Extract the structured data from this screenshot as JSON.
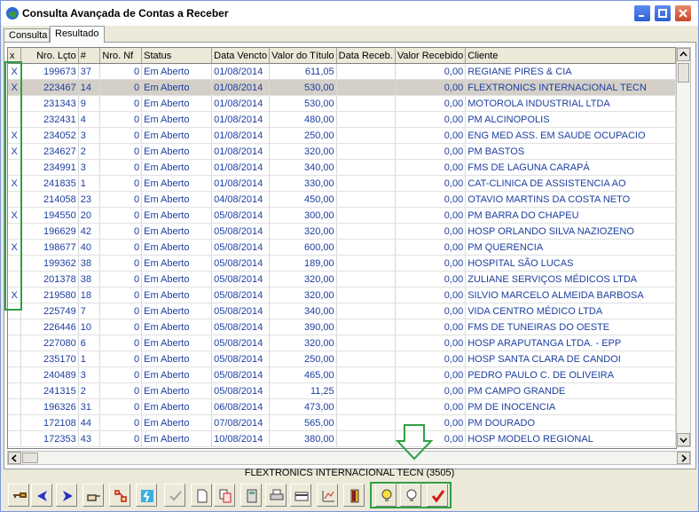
{
  "window": {
    "title": "Consulta Avançada de Contas a Receber"
  },
  "tabs": [
    {
      "label": "Consulta"
    },
    {
      "label": "Resultado"
    }
  ],
  "columns": [
    "x",
    "Nro. Lçto",
    "#",
    "Nro. Nf",
    "Status",
    "Data Vencto",
    "Valor do Título",
    "Data Receb.",
    "Valor Recebido",
    "Cliente"
  ],
  "rows": [
    {
      "x": "X",
      "lcto": "199673",
      "n": "37",
      "nf": "0",
      "status": "Em Aberto",
      "venc": "01/08/2014",
      "valor": "611,05",
      "receb": "",
      "valrec": "0,00",
      "cliente": "REGIANE PIRES & CIA"
    },
    {
      "x": "X",
      "lcto": "223467",
      "n": "14",
      "nf": "0",
      "status": "Em Aberto",
      "venc": "01/08/2014",
      "valor": "530,00",
      "receb": "",
      "valrec": "0,00",
      "cliente": "FLEXTRONICS INTERNACIONAL TECN"
    },
    {
      "x": "",
      "lcto": "231343",
      "n": "9",
      "nf": "0",
      "status": "Em Aberto",
      "venc": "01/08/2014",
      "valor": "530,00",
      "receb": "",
      "valrec": "0,00",
      "cliente": "MOTOROLA INDUSTRIAL LTDA"
    },
    {
      "x": "",
      "lcto": "232431",
      "n": "4",
      "nf": "0",
      "status": "Em Aberto",
      "venc": "01/08/2014",
      "valor": "480,00",
      "receb": "",
      "valrec": "0,00",
      "cliente": "PM ALCINOPOLIS"
    },
    {
      "x": "X",
      "lcto": "234052",
      "n": "3",
      "nf": "0",
      "status": "Em Aberto",
      "venc": "01/08/2014",
      "valor": "250,00",
      "receb": "",
      "valrec": "0,00",
      "cliente": "ENG MED ASS. EM SAUDE OCUPACIO"
    },
    {
      "x": "X",
      "lcto": "234627",
      "n": "2",
      "nf": "0",
      "status": "Em Aberto",
      "venc": "01/08/2014",
      "valor": "320,00",
      "receb": "",
      "valrec": "0,00",
      "cliente": "PM BASTOS"
    },
    {
      "x": "",
      "lcto": "234991",
      "n": "3",
      "nf": "0",
      "status": "Em Aberto",
      "venc": "01/08/2014",
      "valor": "340,00",
      "receb": "",
      "valrec": "0,00",
      "cliente": "FMS DE LAGUNA CARAPÁ"
    },
    {
      "x": "X",
      "lcto": "241835",
      "n": "1",
      "nf": "0",
      "status": "Em Aberto",
      "venc": "01/08/2014",
      "valor": "330,00",
      "receb": "",
      "valrec": "0,00",
      "cliente": "CAT-CLINICA DE ASSISTENCIA AO"
    },
    {
      "x": "",
      "lcto": "214058",
      "n": "23",
      "nf": "0",
      "status": "Em Aberto",
      "venc": "04/08/2014",
      "valor": "450,00",
      "receb": "",
      "valrec": "0,00",
      "cliente": "OTAVIO MARTINS DA COSTA NETO"
    },
    {
      "x": "X",
      "lcto": "194550",
      "n": "20",
      "nf": "0",
      "status": "Em Aberto",
      "venc": "05/08/2014",
      "valor": "300,00",
      "receb": "",
      "valrec": "0,00",
      "cliente": "PM BARRA DO CHAPEU"
    },
    {
      "x": "",
      "lcto": "196629",
      "n": "42",
      "nf": "0",
      "status": "Em Aberto",
      "venc": "05/08/2014",
      "valor": "320,00",
      "receb": "",
      "valrec": "0,00",
      "cliente": "HOSP ORLANDO SILVA NAZIOZENO"
    },
    {
      "x": "X",
      "lcto": "198677",
      "n": "40",
      "nf": "0",
      "status": "Em Aberto",
      "venc": "05/08/2014",
      "valor": "600,00",
      "receb": "",
      "valrec": "0,00",
      "cliente": "PM QUERENCIA"
    },
    {
      "x": "",
      "lcto": "199362",
      "n": "38",
      "nf": "0",
      "status": "Em Aberto",
      "venc": "05/08/2014",
      "valor": "189,00",
      "receb": "",
      "valrec": "0,00",
      "cliente": "HOSPITAL SÃO LUCAS"
    },
    {
      "x": "",
      "lcto": "201378",
      "n": "38",
      "nf": "0",
      "status": "Em Aberto",
      "venc": "05/08/2014",
      "valor": "320,00",
      "receb": "",
      "valrec": "0,00",
      "cliente": "ZULIANE SERVIÇOS MÉDICOS LTDA"
    },
    {
      "x": "X",
      "lcto": "219580",
      "n": "18",
      "nf": "0",
      "status": "Em Aberto",
      "venc": "05/08/2014",
      "valor": "320,00",
      "receb": "",
      "valrec": "0,00",
      "cliente": "SILVIO MARCELO ALMEIDA BARBOSA"
    },
    {
      "x": "",
      "lcto": "225749",
      "n": "7",
      "nf": "0",
      "status": "Em Aberto",
      "venc": "05/08/2014",
      "valor": "340,00",
      "receb": "",
      "valrec": "0,00",
      "cliente": "VIDA CENTRO MÉDICO LTDA"
    },
    {
      "x": "",
      "lcto": "226446",
      "n": "10",
      "nf": "0",
      "status": "Em Aberto",
      "venc": "05/08/2014",
      "valor": "390,00",
      "receb": "",
      "valrec": "0,00",
      "cliente": "FMS DE TUNEIRAS DO OESTE"
    },
    {
      "x": "",
      "lcto": "227080",
      "n": "6",
      "nf": "0",
      "status": "Em Aberto",
      "venc": "05/08/2014",
      "valor": "320,00",
      "receb": "",
      "valrec": "0,00",
      "cliente": "HOSP ARAPUTANGA LTDA. - EPP"
    },
    {
      "x": "",
      "lcto": "235170",
      "n": "1",
      "nf": "0",
      "status": "Em Aberto",
      "venc": "05/08/2014",
      "valor": "250,00",
      "receb": "",
      "valrec": "0,00",
      "cliente": "HOSP SANTA CLARA DE CANDOI"
    },
    {
      "x": "",
      "lcto": "240489",
      "n": "3",
      "nf": "0",
      "status": "Em Aberto",
      "venc": "05/08/2014",
      "valor": "465,00",
      "receb": "",
      "valrec": "0,00",
      "cliente": "PEDRO PAULO C. DE OLIVEIRA"
    },
    {
      "x": "",
      "lcto": "241315",
      "n": "2",
      "nf": "0",
      "status": "Em Aberto",
      "venc": "05/08/2014",
      "valor": "11,25",
      "receb": "",
      "valrec": "0,00",
      "cliente": "PM CAMPO GRANDE"
    },
    {
      "x": "",
      "lcto": "196326",
      "n": "31",
      "nf": "0",
      "status": "Em Aberto",
      "venc": "06/08/2014",
      "valor": "473,00",
      "receb": "",
      "valrec": "0,00",
      "cliente": "PM DE INOCENCIA"
    },
    {
      "x": "",
      "lcto": "172108",
      "n": "44",
      "nf": "0",
      "status": "Em Aberto",
      "venc": "07/08/2014",
      "valor": "565,00",
      "receb": "",
      "valrec": "0,00",
      "cliente": "PM DOURADO"
    },
    {
      "x": "",
      "lcto": "172353",
      "n": "43",
      "nf": "0",
      "status": "Em Aberto",
      "venc": "10/08/2014",
      "valor": "380,00",
      "receb": "",
      "valrec": "0,00",
      "cliente": "HOSP MODELO REGIONAL"
    }
  ],
  "selected_row": 1,
  "status_text": "FLEXTRONICS INTERNACIONAL TECN (3505)",
  "toolbar": [
    "key-icon",
    "prev-arrow-icon",
    "next-arrow-icon",
    "hand-point-icon",
    "move-icon",
    "run-icon",
    "check-gray-icon",
    "new-doc-icon",
    "copy-doc-icon",
    "calculator-icon",
    "print-icon",
    "card-icon",
    "chart-icon",
    "exit-door-icon",
    "bulb-on-icon",
    "bulb-off-icon",
    "red-check-icon"
  ],
  "colors": {
    "highlight": "#2ea043",
    "text_blue": "#1c3fa0",
    "selected_row": "#d4d0c8"
  }
}
